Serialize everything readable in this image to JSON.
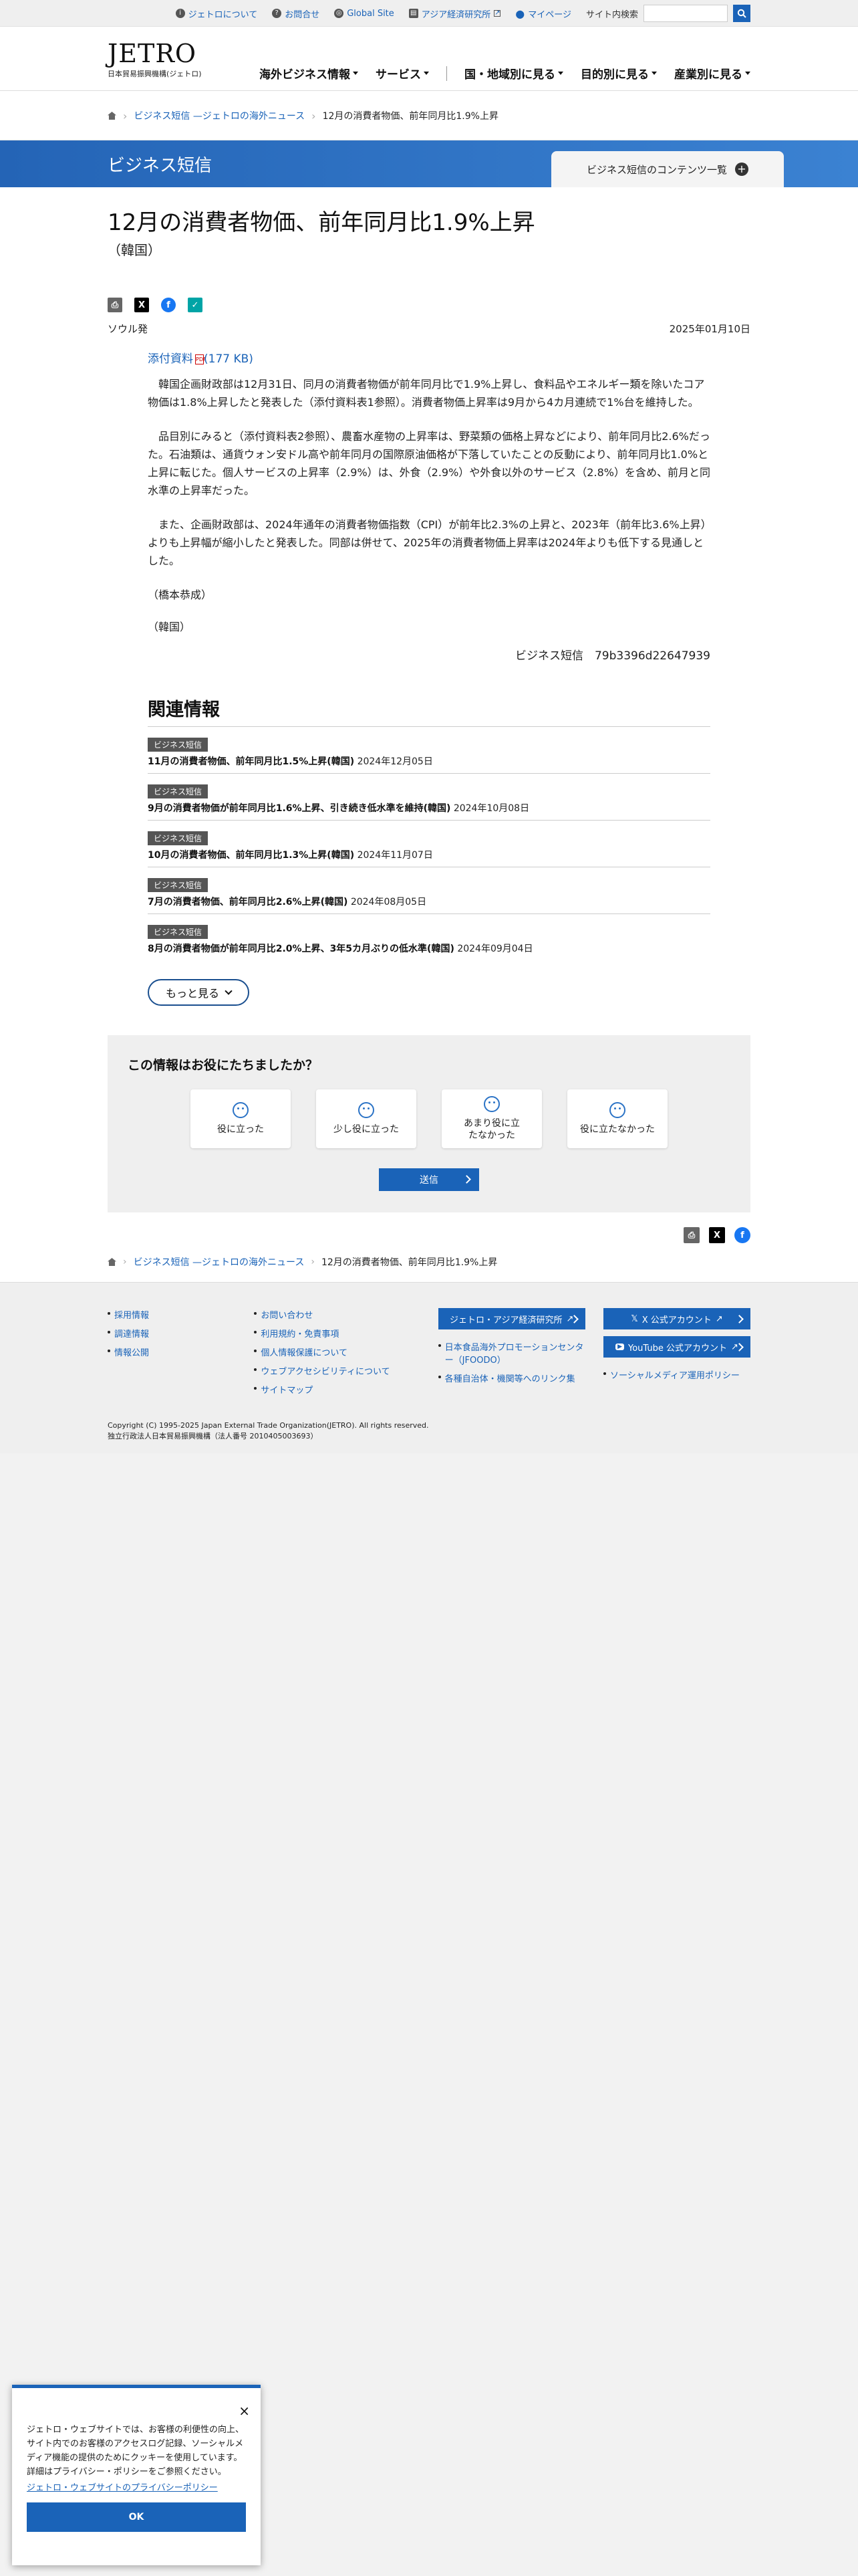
{
  "topbar": {
    "about": "ジェトロについて",
    "contact": "お問合せ",
    "global": "Global Site",
    "ide": "アジア経済研究所",
    "mypage": "マイページ",
    "search_label": "サイト内検索"
  },
  "header": {
    "logo_mark": "JETRO",
    "logo_sub": "日本貿易振興機構(ジェトロ)",
    "nav": [
      "海外ビジネス情報",
      "サービス",
      "国・地域別に見る",
      "目的別に見る",
      "産業別に見る"
    ]
  },
  "breadcrumb": {
    "section": "ビジネス短信 —ジェトロの海外ニュース",
    "current": "12月の消費者物価、前年同月比1.9%上昇"
  },
  "banner": {
    "title": "ビジネス短信",
    "contents_button": "ビジネス短信のコンテンツ一覧"
  },
  "article": {
    "title": "12月の消費者物価、前年同月比1.9%上昇",
    "country": "（韓国）",
    "location": "ソウル発",
    "date": "2025年01月10日",
    "attachment": "添付資料",
    "attachment_size": "(177 KB)",
    "paragraphs": [
      "韓国企画財政部は12月31日、同月の消費者物価が前年同月比で1.9%上昇し、食料品やエネルギー類を除いたコア物価は1.8%上昇したと発表した（添付資料表1参照）。消費者物価上昇率は9月から4カ月連続で1%台を維持した。",
      "品目別にみると（添付資料表2参照）、農畜水産物の上昇率は、野菜類の価格上昇などにより、前年同月比2.6%だった。石油類は、通貨ウォン安ドル高や前年同月の国際原油価格が下落していたことの反動により、前年同月比1.0%と上昇に転じた。個人サービスの上昇率（2.9%）は、外食（2.9%）や外食以外のサービス（2.8%）を含め、前月と同水準の上昇率だった。",
      "また、企画財政部は、2024年通年の消費者物価指数（CPI）が前年比2.3%の上昇と、2023年（前年比3.6%上昇）よりも上昇幅が縮小したと発表した。同部は併せて、2025年の消費者物価上昇率は2024年よりも低下する見通しとした。"
    ],
    "author": "（橋本恭成）",
    "tag": "（韓国）",
    "signature": "ビジネス短信　79b3396d22647939"
  },
  "related": {
    "heading": "関連情報",
    "badge": "ビジネス短信",
    "items": [
      {
        "title": "11月の消費者物価、前年同月比1.5%上昇(韓国)",
        "date": "2024年12月05日"
      },
      {
        "title": "9月の消費者物価が前年同月比1.6%上昇、引き続き低水準を維持(韓国)",
        "date": "2024年10月08日"
      },
      {
        "title": "10月の消費者物価、前年同月比1.3%上昇(韓国)",
        "date": "2024年11月07日"
      },
      {
        "title": "7月の消費者物価、前年同月比2.6%上昇(韓国)",
        "date": "2024年08月05日"
      },
      {
        "title": "8月の消費者物価が前年同月比2.0%上昇、3年5カ月ぶりの低水準(韓国)",
        "date": "2024年09月04日"
      }
    ],
    "more": "もっと見る"
  },
  "survey": {
    "question": "この情報はお役にたちましたか？",
    "options": [
      "役に立った",
      "少し役に立った",
      "あまり役に立たなかった",
      "役に立たなかった"
    ],
    "submit": "送信"
  },
  "footer": {
    "col1": [
      "採用情報",
      "調達情報",
      "情報公開"
    ],
    "col2": [
      "お問い合わせ",
      "利用規約・免責事項",
      "個人情報保護について",
      "ウェブアクセシビリティについて",
      "サイトマップ"
    ],
    "ide_button": "ジェトロ・アジア経済研究所",
    "col3": [
      "日本食品海外プロモーションセンター（JFOODO）",
      "各種自治体・機関等へのリンク集"
    ],
    "x_button": "X 公式アカウント",
    "yt_button": "YouTube 公式アカウント",
    "col4": [
      "ソーシャルメディア運用ポリシー"
    ],
    "copyright": "Copyright (C) 1995-2025 Japan External Trade Organization(JETRO). All rights reserved.",
    "corp_no": "独立行政法人日本貿易振興機構（法人番号 2010405003693）"
  },
  "cookie": {
    "text": "ジェトロ・ウェブサイトでは、お客様の利便性の向上、サイト内でのお客様のアクセスログ記録、ソーシャルメディア機能の提供のためにクッキーを使用しています。詳細はプライバシー・ポリシーをご参照ください。",
    "policy_link": "ジェトロ・ウェブサイトのプライバシーポリシー",
    "ok": "OK",
    "close": "×"
  },
  "colors": {
    "brand_blue": "#1a63b8",
    "banner_blue": "#2464b6"
  },
  "icons": {
    "home": "home-icon",
    "search": "search-icon",
    "print": "print-icon",
    "x": "x-logo-icon",
    "facebook": "facebook-icon",
    "hatena": "hatena-icon"
  }
}
